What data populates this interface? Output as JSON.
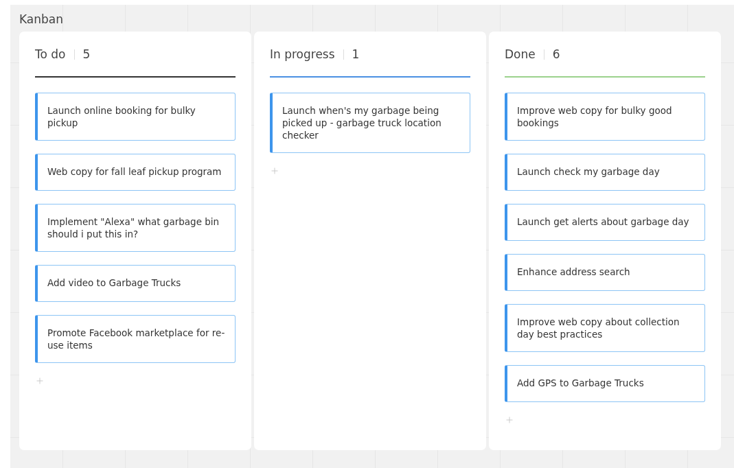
{
  "board": {
    "title": "Kanban"
  },
  "columns": [
    {
      "name": "To do",
      "count": "5",
      "color": "#333333",
      "cards": [
        "Launch online booking for bulky pickup",
        "Web copy for fall leaf pickup program",
        "Implement \"Alexa\" what garbage bin should i put this in?",
        "Add video to Garbage Trucks",
        "Promote Facebook marketplace for re-use items"
      ]
    },
    {
      "name": "In progress",
      "count": "1",
      "color": "#4a90e2",
      "cards": [
        "Launch when's my garbage being picked up - garbage truck location checker"
      ]
    },
    {
      "name": "Done",
      "count": "6",
      "color": "#9bd18c",
      "cards": [
        "Improve web copy for bulky good bookings",
        "Launch check my garbage day",
        "Launch get alerts about garbage day",
        "Enhance address search",
        "Improve web copy about collection day best practices",
        "Add GPS to Garbage Trucks"
      ]
    }
  ]
}
